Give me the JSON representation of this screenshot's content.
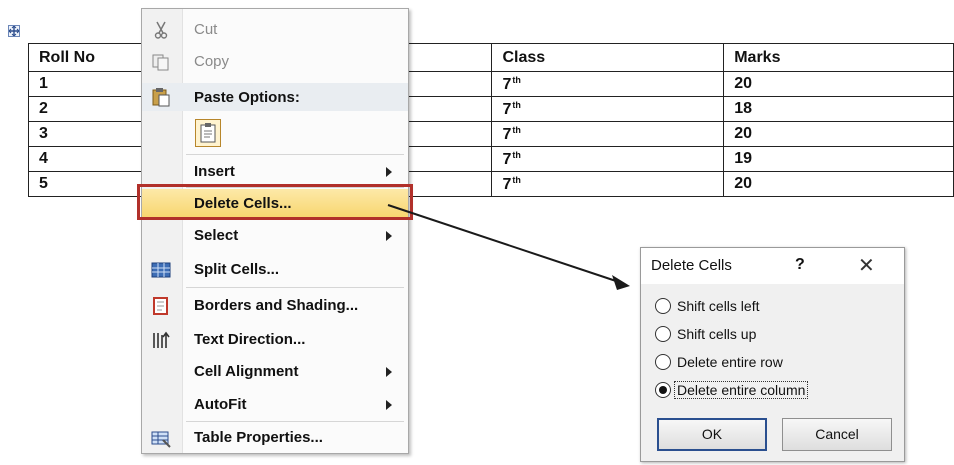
{
  "table": {
    "headers": [
      "Roll No",
      "Class",
      "Marks"
    ],
    "rows": [
      {
        "roll": "1",
        "class_base": "7",
        "class_sup": "th",
        "marks": "20"
      },
      {
        "roll": "2",
        "class_base": "7",
        "class_sup": "th",
        "marks": "18"
      },
      {
        "roll": "3",
        "class_base": "7",
        "class_sup": "th",
        "marks": "20"
      },
      {
        "roll": "4",
        "class_base": "7",
        "class_sup": "th",
        "marks": "19"
      },
      {
        "roll": "5",
        "class_base": "7",
        "class_sup": "th",
        "marks": "20"
      }
    ]
  },
  "context_menu": {
    "items": {
      "cut": "Cut",
      "copy": "Copy",
      "paste_options": "Paste Options:",
      "insert": "Insert",
      "delete_cells": "Delete Cells...",
      "select": "Select",
      "split_cells": "Split Cells...",
      "borders_shading": "Borders and Shading...",
      "text_direction": "Text Direction...",
      "cell_alignment": "Cell Alignment",
      "autofit": "AutoFit",
      "table_properties": "Table Properties..."
    },
    "highlight_color": "#f7d56c",
    "callout_color": "#b1302a"
  },
  "dialog": {
    "title": "Delete Cells",
    "help": "?",
    "close": "✕",
    "options": [
      {
        "label": "Shift cells left",
        "selected": false
      },
      {
        "label": "Shift cells up",
        "selected": false
      },
      {
        "label": "Delete entire row",
        "selected": false
      },
      {
        "label": "Delete entire column",
        "selected": true
      }
    ],
    "ok": "OK",
    "cancel": "Cancel"
  },
  "icons": {
    "table_move": "move-handle-icon",
    "cut": "scissors-icon",
    "copy": "copy-icon",
    "paste": "clipboard-icon",
    "split_cells": "split-cells-icon",
    "borders": "borders-icon",
    "text_direction": "text-direction-icon",
    "table_properties": "table-properties-icon"
  }
}
